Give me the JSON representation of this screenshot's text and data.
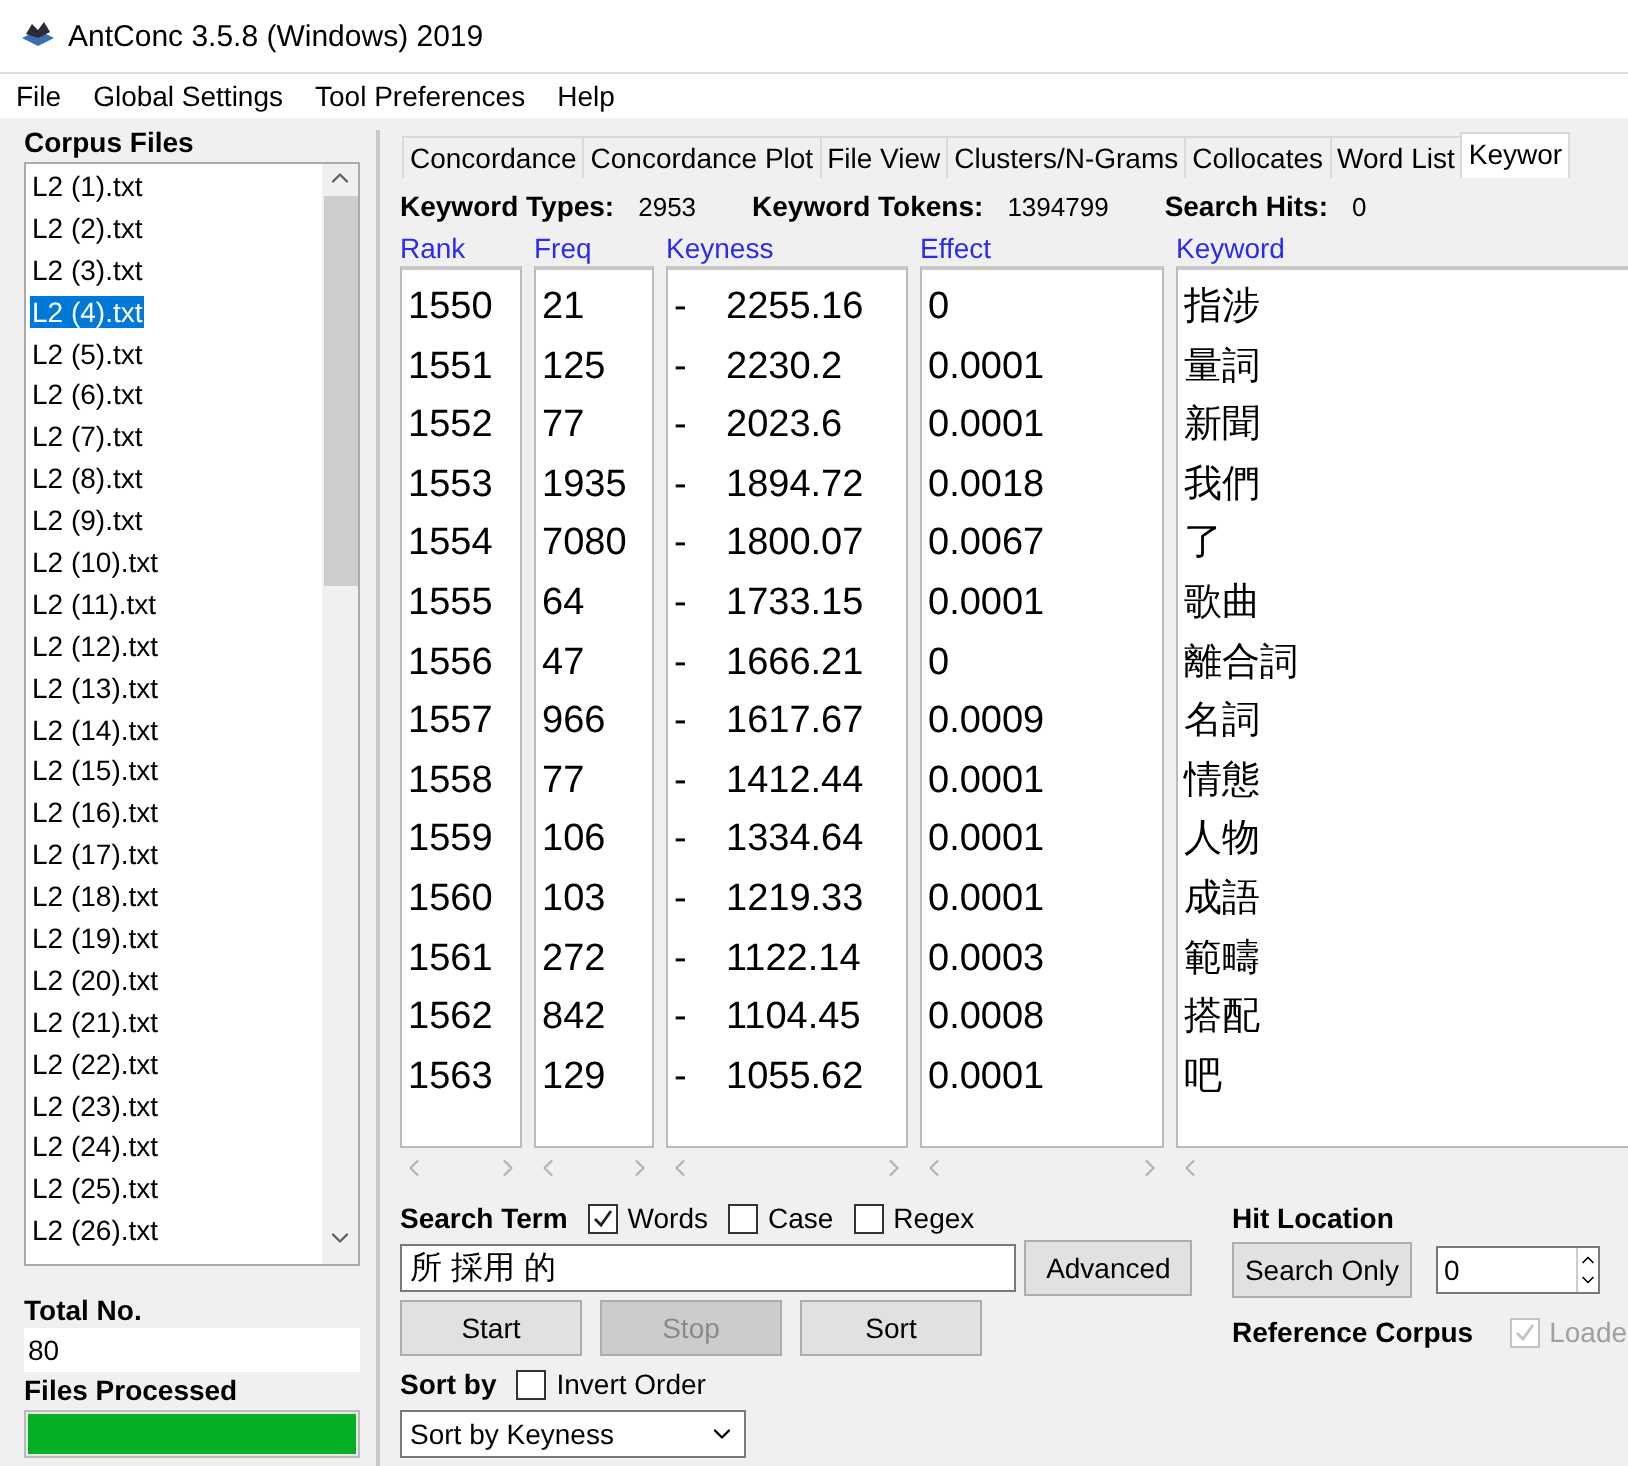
{
  "window": {
    "title": "AntConc 3.5.8 (Windows) 2019"
  },
  "menu": [
    "File",
    "Global Settings",
    "Tool Preferences",
    "Help"
  ],
  "corpus_files": {
    "title": "Corpus Files",
    "items": [
      {
        "label": "L2 (1).txt",
        "selected": false
      },
      {
        "label": "L2 (2).txt",
        "selected": false
      },
      {
        "label": "L2 (3).txt",
        "selected": false
      },
      {
        "label": "L2 (4).txt",
        "selected": true
      },
      {
        "label": "L2 (5).txt",
        "selected": false
      },
      {
        "label": "L2 (6).txt",
        "selected": false
      },
      {
        "label": "L2 (7).txt",
        "selected": false
      },
      {
        "label": "L2 (8).txt",
        "selected": false
      },
      {
        "label": "L2 (9).txt",
        "selected": false
      },
      {
        "label": "L2 (10).txt",
        "selected": false
      },
      {
        "label": "L2 (11).txt",
        "selected": false
      },
      {
        "label": "L2 (12).txt",
        "selected": false
      },
      {
        "label": "L2 (13).txt",
        "selected": false
      },
      {
        "label": "L2 (14).txt",
        "selected": false
      },
      {
        "label": "L2 (15).txt",
        "selected": false
      },
      {
        "label": "L2 (16).txt",
        "selected": false
      },
      {
        "label": "L2 (17).txt",
        "selected": false
      },
      {
        "label": "L2 (18).txt",
        "selected": false
      },
      {
        "label": "L2 (19).txt",
        "selected": false
      },
      {
        "label": "L2 (20).txt",
        "selected": false
      },
      {
        "label": "L2 (21).txt",
        "selected": false
      },
      {
        "label": "L2 (22).txt",
        "selected": false
      },
      {
        "label": "L2 (23).txt",
        "selected": false
      },
      {
        "label": "L2 (24).txt",
        "selected": false
      },
      {
        "label": "L2 (25).txt",
        "selected": false
      },
      {
        "label": "L2 (26).txt",
        "selected": false
      }
    ]
  },
  "total_no": {
    "label": "Total No.",
    "value": "80"
  },
  "files_processed": {
    "label": "Files Processed",
    "level": 1
  },
  "tabs": [
    {
      "label": "Concordance",
      "selected": false
    },
    {
      "label": "Concordance Plot",
      "selected": false
    },
    {
      "label": "File View",
      "selected": false
    },
    {
      "label": "Clusters/N-Grams",
      "selected": false
    },
    {
      "label": "Collocates",
      "selected": false
    },
    {
      "label": "Word List",
      "selected": false
    },
    {
      "label": "Keywor",
      "selected": true
    }
  ],
  "stats": [
    {
      "label": "Keyword Types:",
      "value": "2953"
    },
    {
      "label": "Keyword Tokens:",
      "value": "1394799"
    },
    {
      "label": "Search Hits:",
      "value": "0"
    }
  ],
  "table": {
    "columns": [
      "Rank",
      "Freq",
      "Keyness",
      "Effect",
      "Keyword"
    ],
    "rows": [
      {
        "rank": "1550",
        "freq": "21",
        "sign": "-",
        "keyness": "2255.16",
        "effect": "0",
        "keyword": "指涉"
      },
      {
        "rank": "1551",
        "freq": "125",
        "sign": "-",
        "keyness": "2230.2",
        "effect": "0.0001",
        "keyword": "量詞"
      },
      {
        "rank": "1552",
        "freq": "77",
        "sign": "-",
        "keyness": "2023.6",
        "effect": "0.0001",
        "keyword": "新聞"
      },
      {
        "rank": "1553",
        "freq": "1935",
        "sign": "-",
        "keyness": "1894.72",
        "effect": "0.0018",
        "keyword": "我們"
      },
      {
        "rank": "1554",
        "freq": "7080",
        "sign": "-",
        "keyness": "1800.07",
        "effect": "0.0067",
        "keyword": "了"
      },
      {
        "rank": "1555",
        "freq": "64",
        "sign": "-",
        "keyness": "1733.15",
        "effect": "0.0001",
        "keyword": "歌曲"
      },
      {
        "rank": "1556",
        "freq": "47",
        "sign": "-",
        "keyness": "1666.21",
        "effect": "0",
        "keyword": "離合詞"
      },
      {
        "rank": "1557",
        "freq": "966",
        "sign": "-",
        "keyness": "1617.67",
        "effect": "0.0009",
        "keyword": "名詞"
      },
      {
        "rank": "1558",
        "freq": "77",
        "sign": "-",
        "keyness": "1412.44",
        "effect": "0.0001",
        "keyword": "情態"
      },
      {
        "rank": "1559",
        "freq": "106",
        "sign": "-",
        "keyness": "1334.64",
        "effect": "0.0001",
        "keyword": "人物"
      },
      {
        "rank": "1560",
        "freq": "103",
        "sign": "-",
        "keyness": "1219.33",
        "effect": "0.0001",
        "keyword": "成語"
      },
      {
        "rank": "1561",
        "freq": "272",
        "sign": "-",
        "keyness": "1122.14",
        "effect": "0.0003",
        "keyword": "範疇"
      },
      {
        "rank": "1562",
        "freq": "842",
        "sign": "-",
        "keyness": "1104.45",
        "effect": "0.0008",
        "keyword": "搭配"
      },
      {
        "rank": "1563",
        "freq": "129",
        "sign": "-",
        "keyness": "1055.62",
        "effect": "0.0001",
        "keyword": "吧"
      }
    ]
  },
  "search": {
    "label": "Search Term",
    "options": [
      {
        "label": "Words",
        "checked": true
      },
      {
        "label": "Case",
        "checked": false
      },
      {
        "label": "Regex",
        "checked": false
      }
    ],
    "value": "所 採用 的",
    "advanced": "Advanced"
  },
  "buttons": [
    {
      "label": "Start",
      "disabled": false
    },
    {
      "label": "Stop",
      "disabled": true
    },
    {
      "label": "Sort",
      "disabled": false
    }
  ],
  "hit_location": {
    "label": "Hit Location",
    "button": "Search Only",
    "value": "0"
  },
  "reference_corpus": {
    "label": "Reference Corpus",
    "option": {
      "label": "Loade",
      "checked": true,
      "disabled": true
    }
  },
  "sort": {
    "label": "Sort by",
    "invert": {
      "label": "Invert Order",
      "checked": false
    },
    "value": "Sort by Keyness"
  }
}
